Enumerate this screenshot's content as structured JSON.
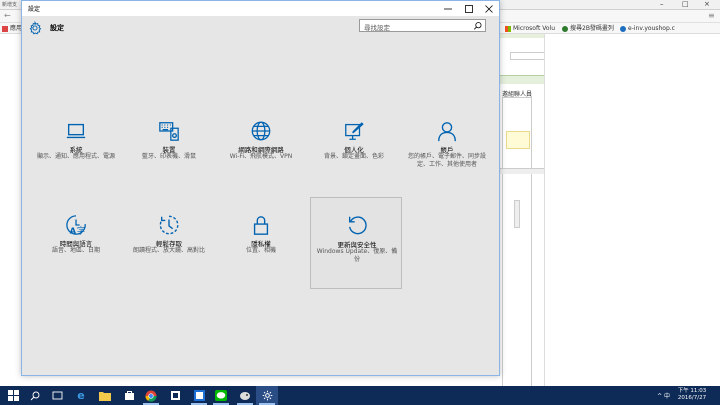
{
  "browser": {
    "tab_title": "新增支",
    "bookmarks": [
      {
        "label": "應用",
        "color": "#d44"
      },
      {
        "label": "Microsoft Volu",
        "color": "#f25022"
      },
      {
        "label": "搜尋2B發碼畫列",
        "color": "#2d7a2d"
      },
      {
        "label": "e-inv.youshop.c",
        "color": "#1e6fbf"
      }
    ],
    "page_label": "邀組聯人員"
  },
  "settings": {
    "window_title": "設定",
    "app_title": "設定",
    "search_placeholder": "尋找設定",
    "accent": "#0063b1",
    "tiles": [
      {
        "id": "system",
        "name": "系統",
        "desc": "顯示、通知、應用程式、電源",
        "icon": "laptop-icon"
      },
      {
        "id": "devices",
        "name": "裝置",
        "desc": "藍牙、印表機、滑鼠",
        "icon": "keyboard-icon"
      },
      {
        "id": "network",
        "name": "網路和網際網路",
        "desc": "Wi-Fi、飛航模式、VPN",
        "icon": "globe-icon"
      },
      {
        "id": "personalization",
        "name": "個人化",
        "desc": "背景、鎖定畫面、色彩",
        "icon": "paint-icon"
      },
      {
        "id": "accounts",
        "name": "帳戶",
        "desc": "您的帳戶、電子郵件、同步設定、工作、其他使用者",
        "icon": "person-icon"
      },
      {
        "id": "time",
        "name": "時間與語言",
        "desc": "語音、地區、日期",
        "icon": "language-icon"
      },
      {
        "id": "ease",
        "name": "輕鬆存取",
        "desc": "朗讀程式、放大鏡、高對比",
        "icon": "ease-of-access-icon"
      },
      {
        "id": "privacy",
        "name": "隱私權",
        "desc": "位置、相機",
        "icon": "lock-icon"
      },
      {
        "id": "update",
        "name": "更新與安全性",
        "desc": "Windows Update、復原、備份",
        "icon": "refresh-icon"
      }
    ]
  },
  "taskbar": {
    "time": "下午 11:03",
    "date": "2016/7/27",
    "tray_text": "^ 中"
  }
}
